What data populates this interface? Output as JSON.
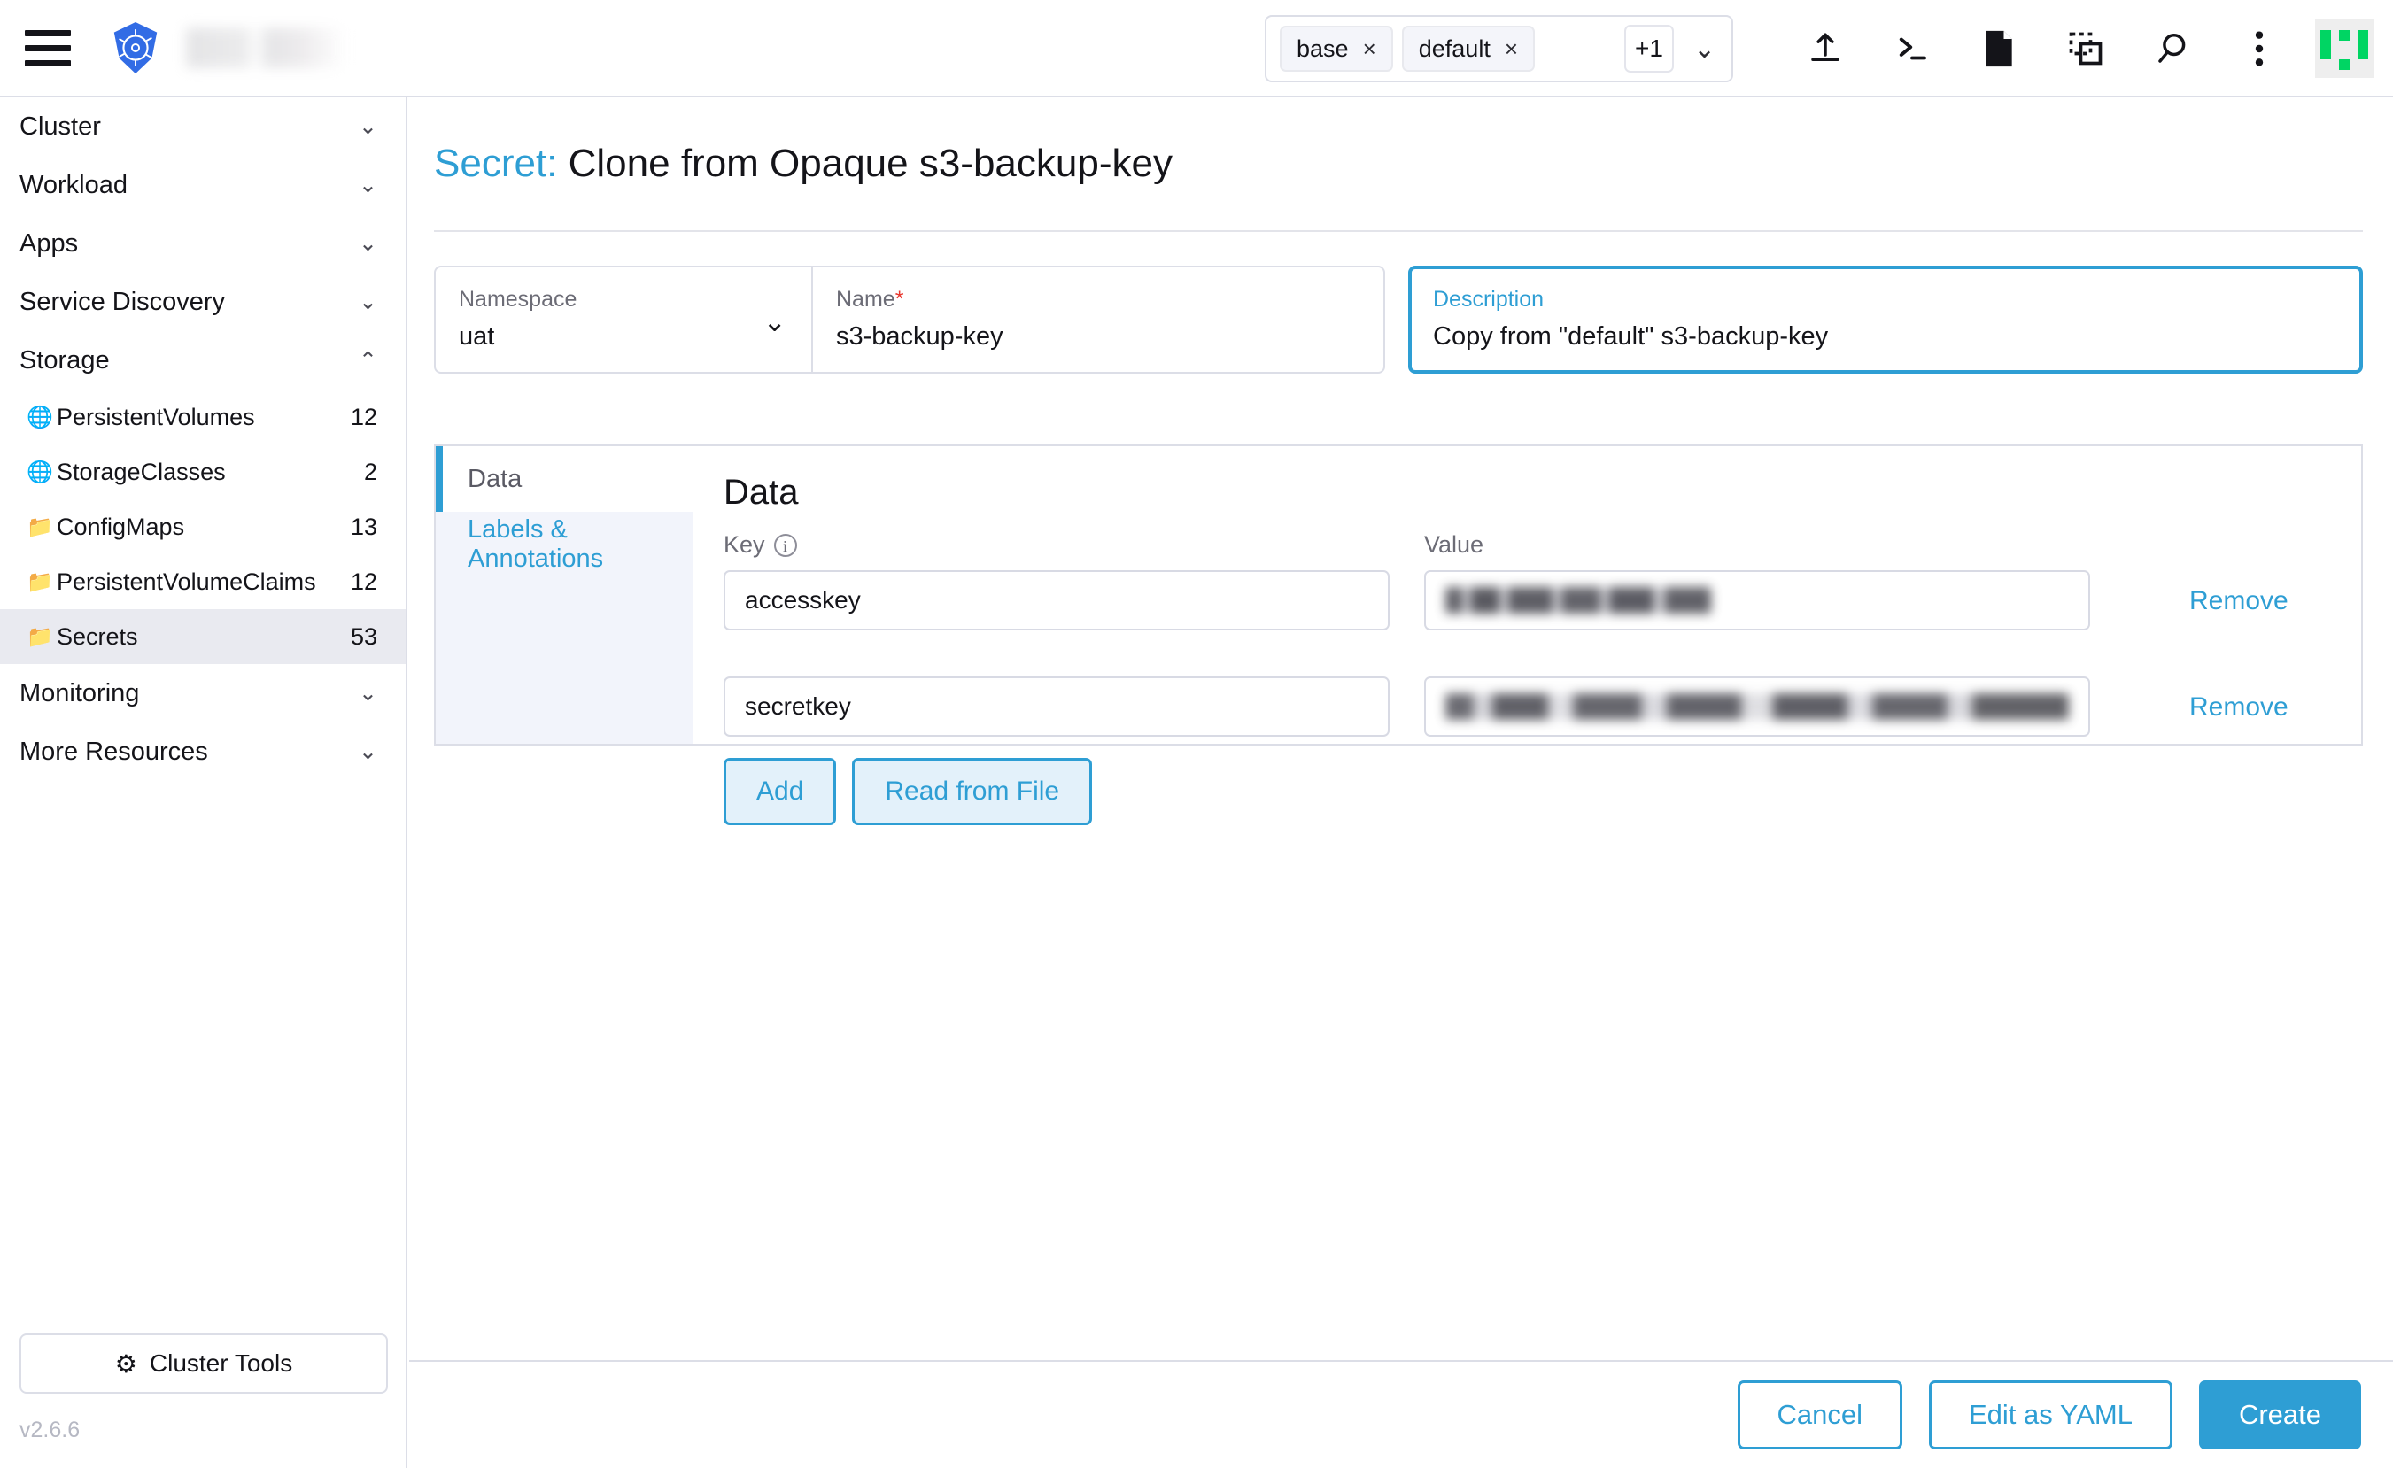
{
  "header": {
    "menu_icon": "hamburger-icon",
    "logo_icon": "kubernetes-logo",
    "cluster_name": "",
    "namespace_picker": {
      "chips": [
        {
          "label": "base",
          "close": "×"
        },
        {
          "label": "default",
          "close": "×"
        }
      ],
      "more_badge": "+1",
      "chevron": "⌄"
    },
    "icons": [
      {
        "name": "import-upload-icon"
      },
      {
        "name": "kubectl-shell-icon"
      },
      {
        "name": "docs-file-icon"
      },
      {
        "name": "copy-kubeconfig-icon"
      },
      {
        "name": "search-icon"
      },
      {
        "name": "kebab-menu-icon"
      }
    ],
    "avatar": {
      "name": "user-avatar",
      "color": "#00d563"
    }
  },
  "sidebar": {
    "groups": [
      {
        "label": "Cluster",
        "expanded": false,
        "chevron": "⌄"
      },
      {
        "label": "Workload",
        "expanded": false,
        "chevron": "⌄"
      },
      {
        "label": "Apps",
        "expanded": false,
        "chevron": "⌄"
      },
      {
        "label": "Service Discovery",
        "expanded": false,
        "chevron": "⌄"
      },
      {
        "label": "Storage",
        "expanded": true,
        "chevron": "⌃"
      }
    ],
    "storage_items": [
      {
        "label": "PersistentVolumes",
        "count": "12",
        "icon": "globe-icon",
        "active": false
      },
      {
        "label": "StorageClasses",
        "count": "2",
        "icon": "globe-icon",
        "active": false
      },
      {
        "label": "ConfigMaps",
        "count": "13",
        "icon": "folder-icon",
        "active": false
      },
      {
        "label": "PersistentVolumeClaims",
        "count": "12",
        "icon": "folder-icon",
        "active": false
      },
      {
        "label": "Secrets",
        "count": "53",
        "icon": "folder-icon",
        "active": true
      }
    ],
    "trailing_groups": [
      {
        "label": "Monitoring",
        "chevron": "⌄"
      },
      {
        "label": "More Resources",
        "chevron": "⌄"
      }
    ],
    "cluster_tools": {
      "label": "Cluster Tools",
      "icon": "gear-icon"
    },
    "version": "v2.6.6"
  },
  "page": {
    "title_prefix": "Secret:",
    "title": "Clone from Opaque s3-backup-key",
    "accent_color": "#2e9ed4"
  },
  "form": {
    "namespace": {
      "label": "Namespace",
      "value": "uat",
      "chevron": "⌄"
    },
    "name": {
      "label": "Name",
      "required": "*",
      "value": "s3-backup-key"
    },
    "description": {
      "label": "Description",
      "value": "Copy from \"default\" s3-backup-key",
      "focused": true
    }
  },
  "tabs": [
    {
      "label": "Data",
      "active": true
    },
    {
      "label": "Labels & Annotations",
      "active": false
    }
  ],
  "data_section": {
    "heading": "Data",
    "columns": {
      "key": "Key",
      "key_info_icon": "info-icon",
      "value": "Value"
    },
    "rows": [
      {
        "key": "accesskey",
        "value": "",
        "value_redacted": true,
        "remove_label": "Remove"
      },
      {
        "key": "secretkey",
        "value": "",
        "value_redacted": true,
        "remove_label": "Remove"
      }
    ],
    "buttons": [
      {
        "label": "Add"
      },
      {
        "label": "Read from File"
      }
    ]
  },
  "footer": {
    "cancel": "Cancel",
    "edit_yaml": "Edit as YAML",
    "create": "Create"
  }
}
